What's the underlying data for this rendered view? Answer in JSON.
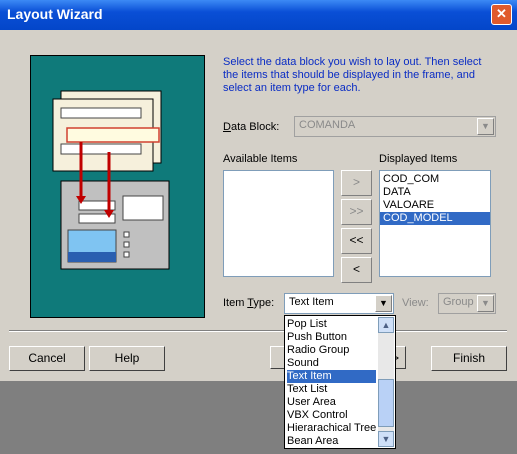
{
  "window": {
    "title": "Layout Wizard"
  },
  "instructions": "Select the data block you wish to lay out. Then select the items that should be displayed in the frame, and select an item type for each.",
  "data_block": {
    "label_underline": "D",
    "label_rest": "ata Block:",
    "value": "COMANDA"
  },
  "available": {
    "label": "Available Items",
    "items": []
  },
  "displayed": {
    "label": "Displayed Items",
    "items": [
      "COD_COM",
      "DATA",
      "VALOARE",
      "COD_MODEL"
    ],
    "selected": "COD_MODEL"
  },
  "move_buttons": {
    "add": ">",
    "add_all": ">>",
    "remove_all": "<<",
    "remove": "<"
  },
  "item_type": {
    "label_pre": "Item ",
    "label_underline": "T",
    "label_post": "ype:",
    "value": "Text Item",
    "options": [
      "Pop List",
      "Push Button",
      "Radio Group",
      "Sound",
      "Text Item",
      "Text List",
      "User Area",
      "VBX Control",
      "Hierarachical Tree",
      "Bean Area"
    ],
    "selected": "Text Item"
  },
  "view": {
    "label": "View:",
    "value": "Group"
  },
  "buttons": {
    "cancel": "Cancel",
    "help": "Help",
    "next": ">",
    "finish": "Finish"
  },
  "icons": {
    "close": "close-icon",
    "combo_arrow": "chevron-down-icon"
  },
  "colors": {
    "title_bar": "#0a52d8",
    "illustration_bg": "#0f7a7a",
    "instruction_text": "#0a2cc4",
    "selection": "#316ac5"
  }
}
